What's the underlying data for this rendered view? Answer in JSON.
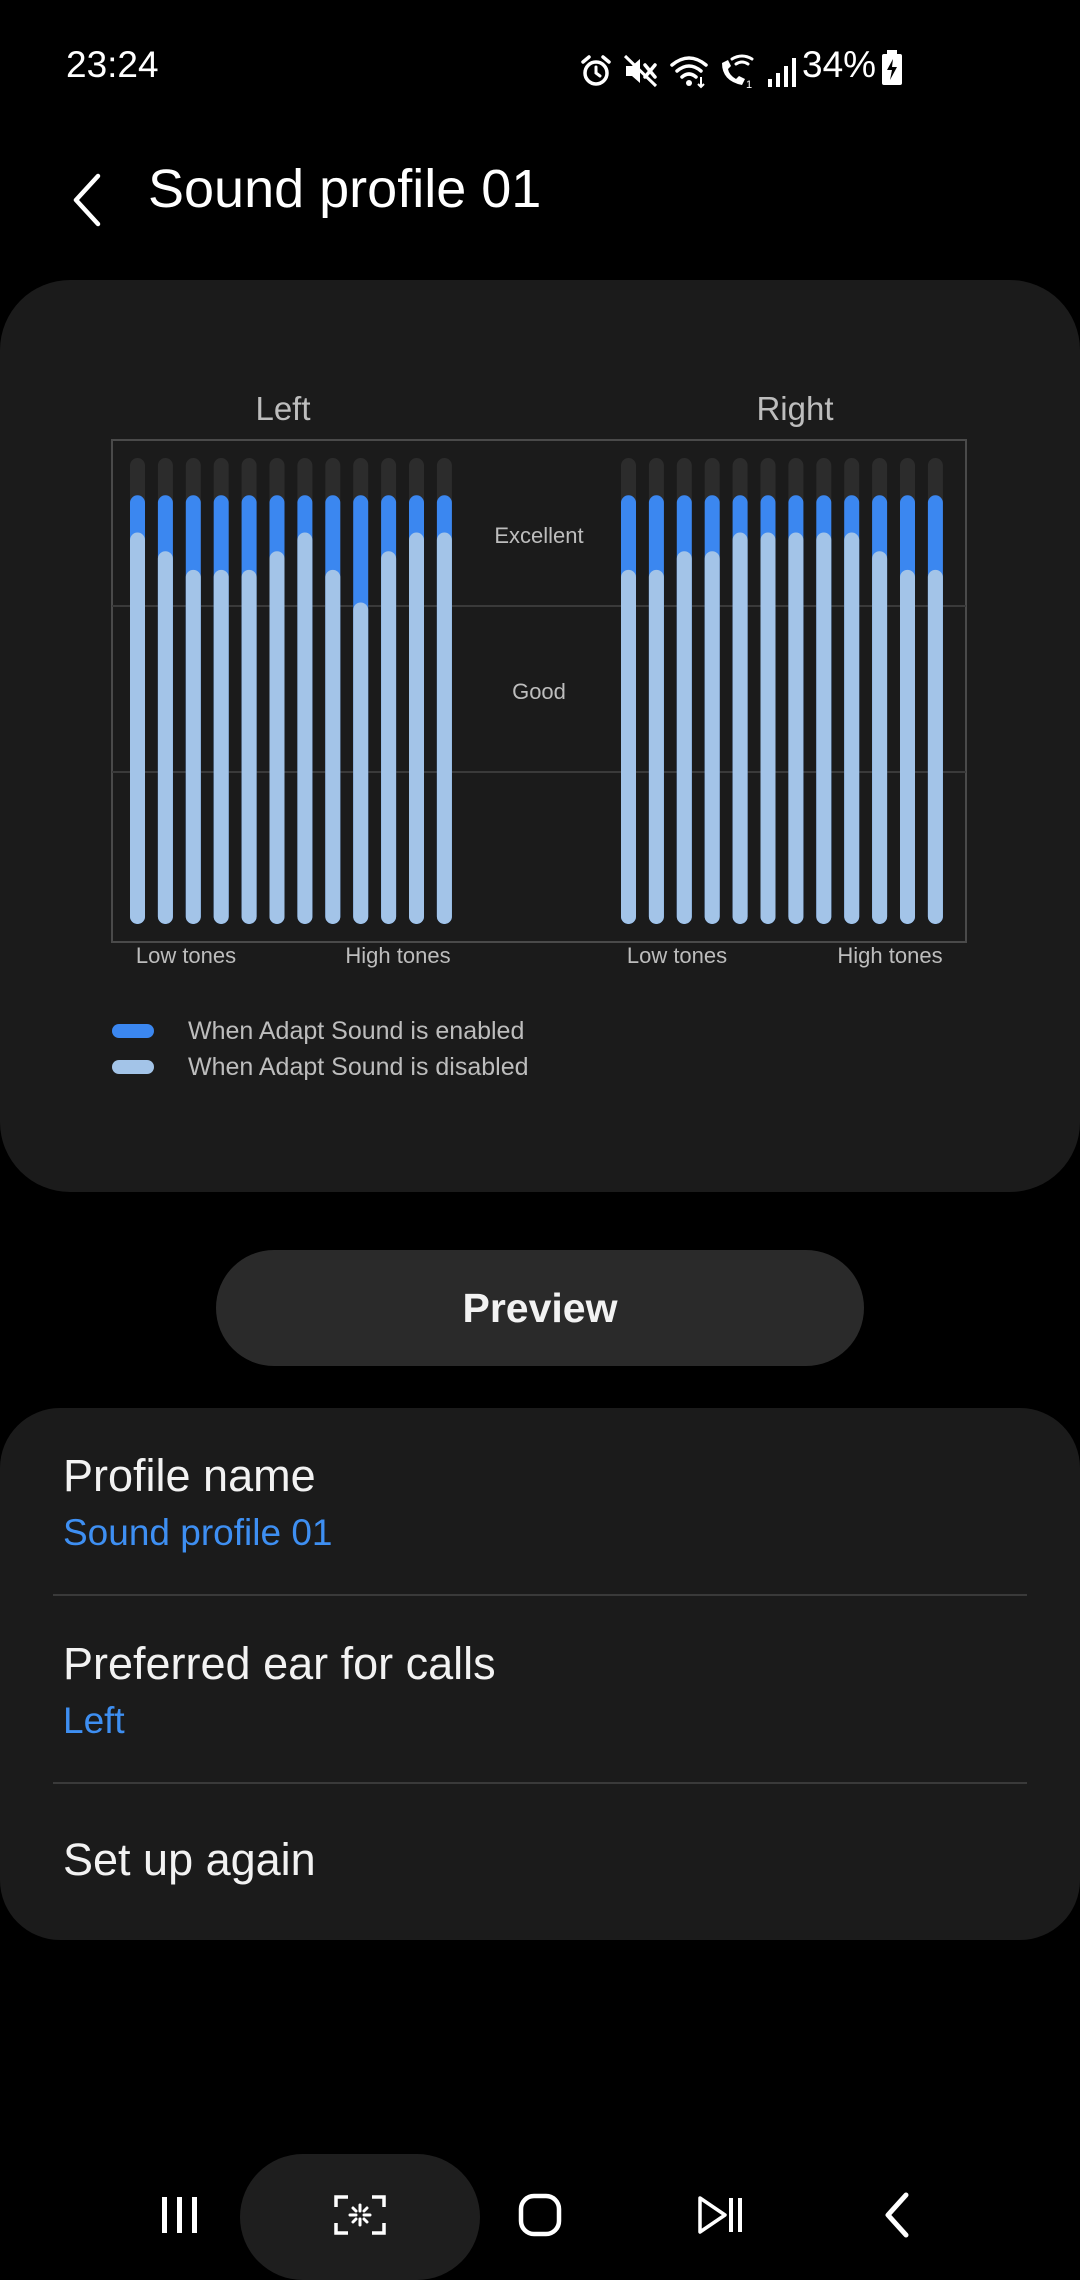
{
  "status_bar": {
    "time": "23:24",
    "battery": "34%",
    "icons": [
      "alarm-icon",
      "mute-icon",
      "wifi-icon",
      "wifi-calling-icon",
      "signal-icon",
      "battery-charging-icon"
    ]
  },
  "header": {
    "title": "Sound profile 01",
    "back_icon": "back-icon"
  },
  "chart_data": {
    "type": "bar",
    "panels": [
      "Left",
      "Right"
    ],
    "levels": [
      "Excellent",
      "Good"
    ],
    "x_axis_labels": [
      "Low tones",
      "High tones"
    ],
    "legend": [
      {
        "label": "When Adapt Sound is enabled",
        "color": "#3b87f0"
      },
      {
        "label": "When Adapt Sound is disabled",
        "color": "#a3c4e8"
      }
    ],
    "scale_note": "Bars represent hearing level from bottom (0) to top (1); grid lines mark the Good and Excellent bands",
    "left": {
      "enabled": [
        0.92,
        0.92,
        0.92,
        0.92,
        0.92,
        0.92,
        0.92,
        0.92,
        0.92,
        0.92,
        0.92,
        0.92
      ],
      "disabled": [
        0.84,
        0.8,
        0.76,
        0.76,
        0.76,
        0.8,
        0.84,
        0.76,
        0.69,
        0.8,
        0.84,
        0.84
      ]
    },
    "right": {
      "enabled": [
        0.92,
        0.92,
        0.92,
        0.92,
        0.92,
        0.92,
        0.92,
        0.92,
        0.92,
        0.92,
        0.92,
        0.92
      ],
      "disabled": [
        0.76,
        0.76,
        0.8,
        0.8,
        0.84,
        0.84,
        0.84,
        0.84,
        0.84,
        0.8,
        0.76,
        0.76
      ]
    }
  },
  "preview_button": {
    "label": "Preview"
  },
  "settings": {
    "profile_name": {
      "title": "Profile name",
      "value": "Sound profile 01"
    },
    "preferred_ear": {
      "title": "Preferred ear for calls",
      "value": "Left"
    },
    "setup_again": {
      "title": "Set up again"
    }
  },
  "nav_bar": {
    "icons": [
      "recents-icon",
      "capture-icon",
      "home-icon",
      "media-icon",
      "back-icon"
    ]
  },
  "colors": {
    "accent": "#3e8ff2",
    "bar_enabled": "#3b87f0",
    "bar_disabled": "#a3c4e8",
    "bar_track": "#2c2c2c",
    "card_bg": "#1b1b1b"
  }
}
